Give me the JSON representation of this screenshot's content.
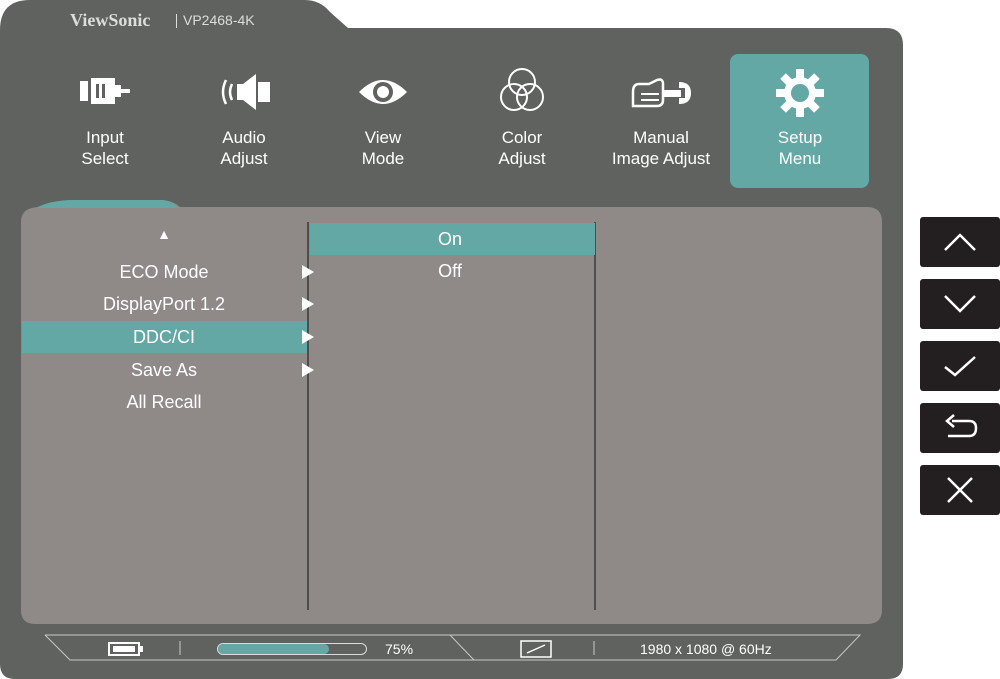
{
  "header": {
    "brand": "ViewSonic",
    "model": "VP2468-4K"
  },
  "tabs": [
    {
      "line1": "Input",
      "line2": "Select",
      "icon": "input-select-icon"
    },
    {
      "line1": "Audio",
      "line2": "Adjust",
      "icon": "speaker-icon"
    },
    {
      "line1": "View",
      "line2": "Mode",
      "icon": "eye-icon"
    },
    {
      "line1": "Color",
      "line2": "Adjust",
      "icon": "color-circles-icon"
    },
    {
      "line1": "Manual",
      "line2": "Image Adjust",
      "icon": "hand-wrench-icon"
    },
    {
      "line1": "Setup",
      "line2": "Menu",
      "icon": "gear-icon",
      "selected": true
    }
  ],
  "menu": {
    "scroll_up_glyph": "▲",
    "items": [
      {
        "label": "ECO Mode",
        "has_submenu": true
      },
      {
        "label": "DisplayPort 1.2",
        "has_submenu": true
      },
      {
        "label": "DDC/CI",
        "has_submenu": true,
        "selected": true
      },
      {
        "label": "Save As",
        "has_submenu": true
      },
      {
        "label": "All Recall",
        "has_submenu": false
      }
    ]
  },
  "submenu": {
    "items": [
      {
        "label": "On",
        "selected": true
      },
      {
        "label": "Off",
        "selected": false
      }
    ]
  },
  "status_bar": {
    "battery_icon": "battery-icon",
    "level_percent": 75,
    "level_text": "75%",
    "display_icon": "display-icon",
    "resolution": "1980 x 1080 @ 60Hz"
  },
  "keys": [
    {
      "name": "up-key",
      "icon": "chevron-up-icon"
    },
    {
      "name": "down-key",
      "icon": "chevron-down-icon"
    },
    {
      "name": "confirm-key",
      "icon": "checkmark-icon"
    },
    {
      "name": "back-key",
      "icon": "return-arrow-icon"
    },
    {
      "name": "close-key",
      "icon": "close-icon"
    }
  ],
  "colors": {
    "frame": "#5f625f",
    "panel": "#8f8a88",
    "accent": "#64a8a6",
    "key_bg": "#231f20",
    "text": "#ffffff"
  }
}
